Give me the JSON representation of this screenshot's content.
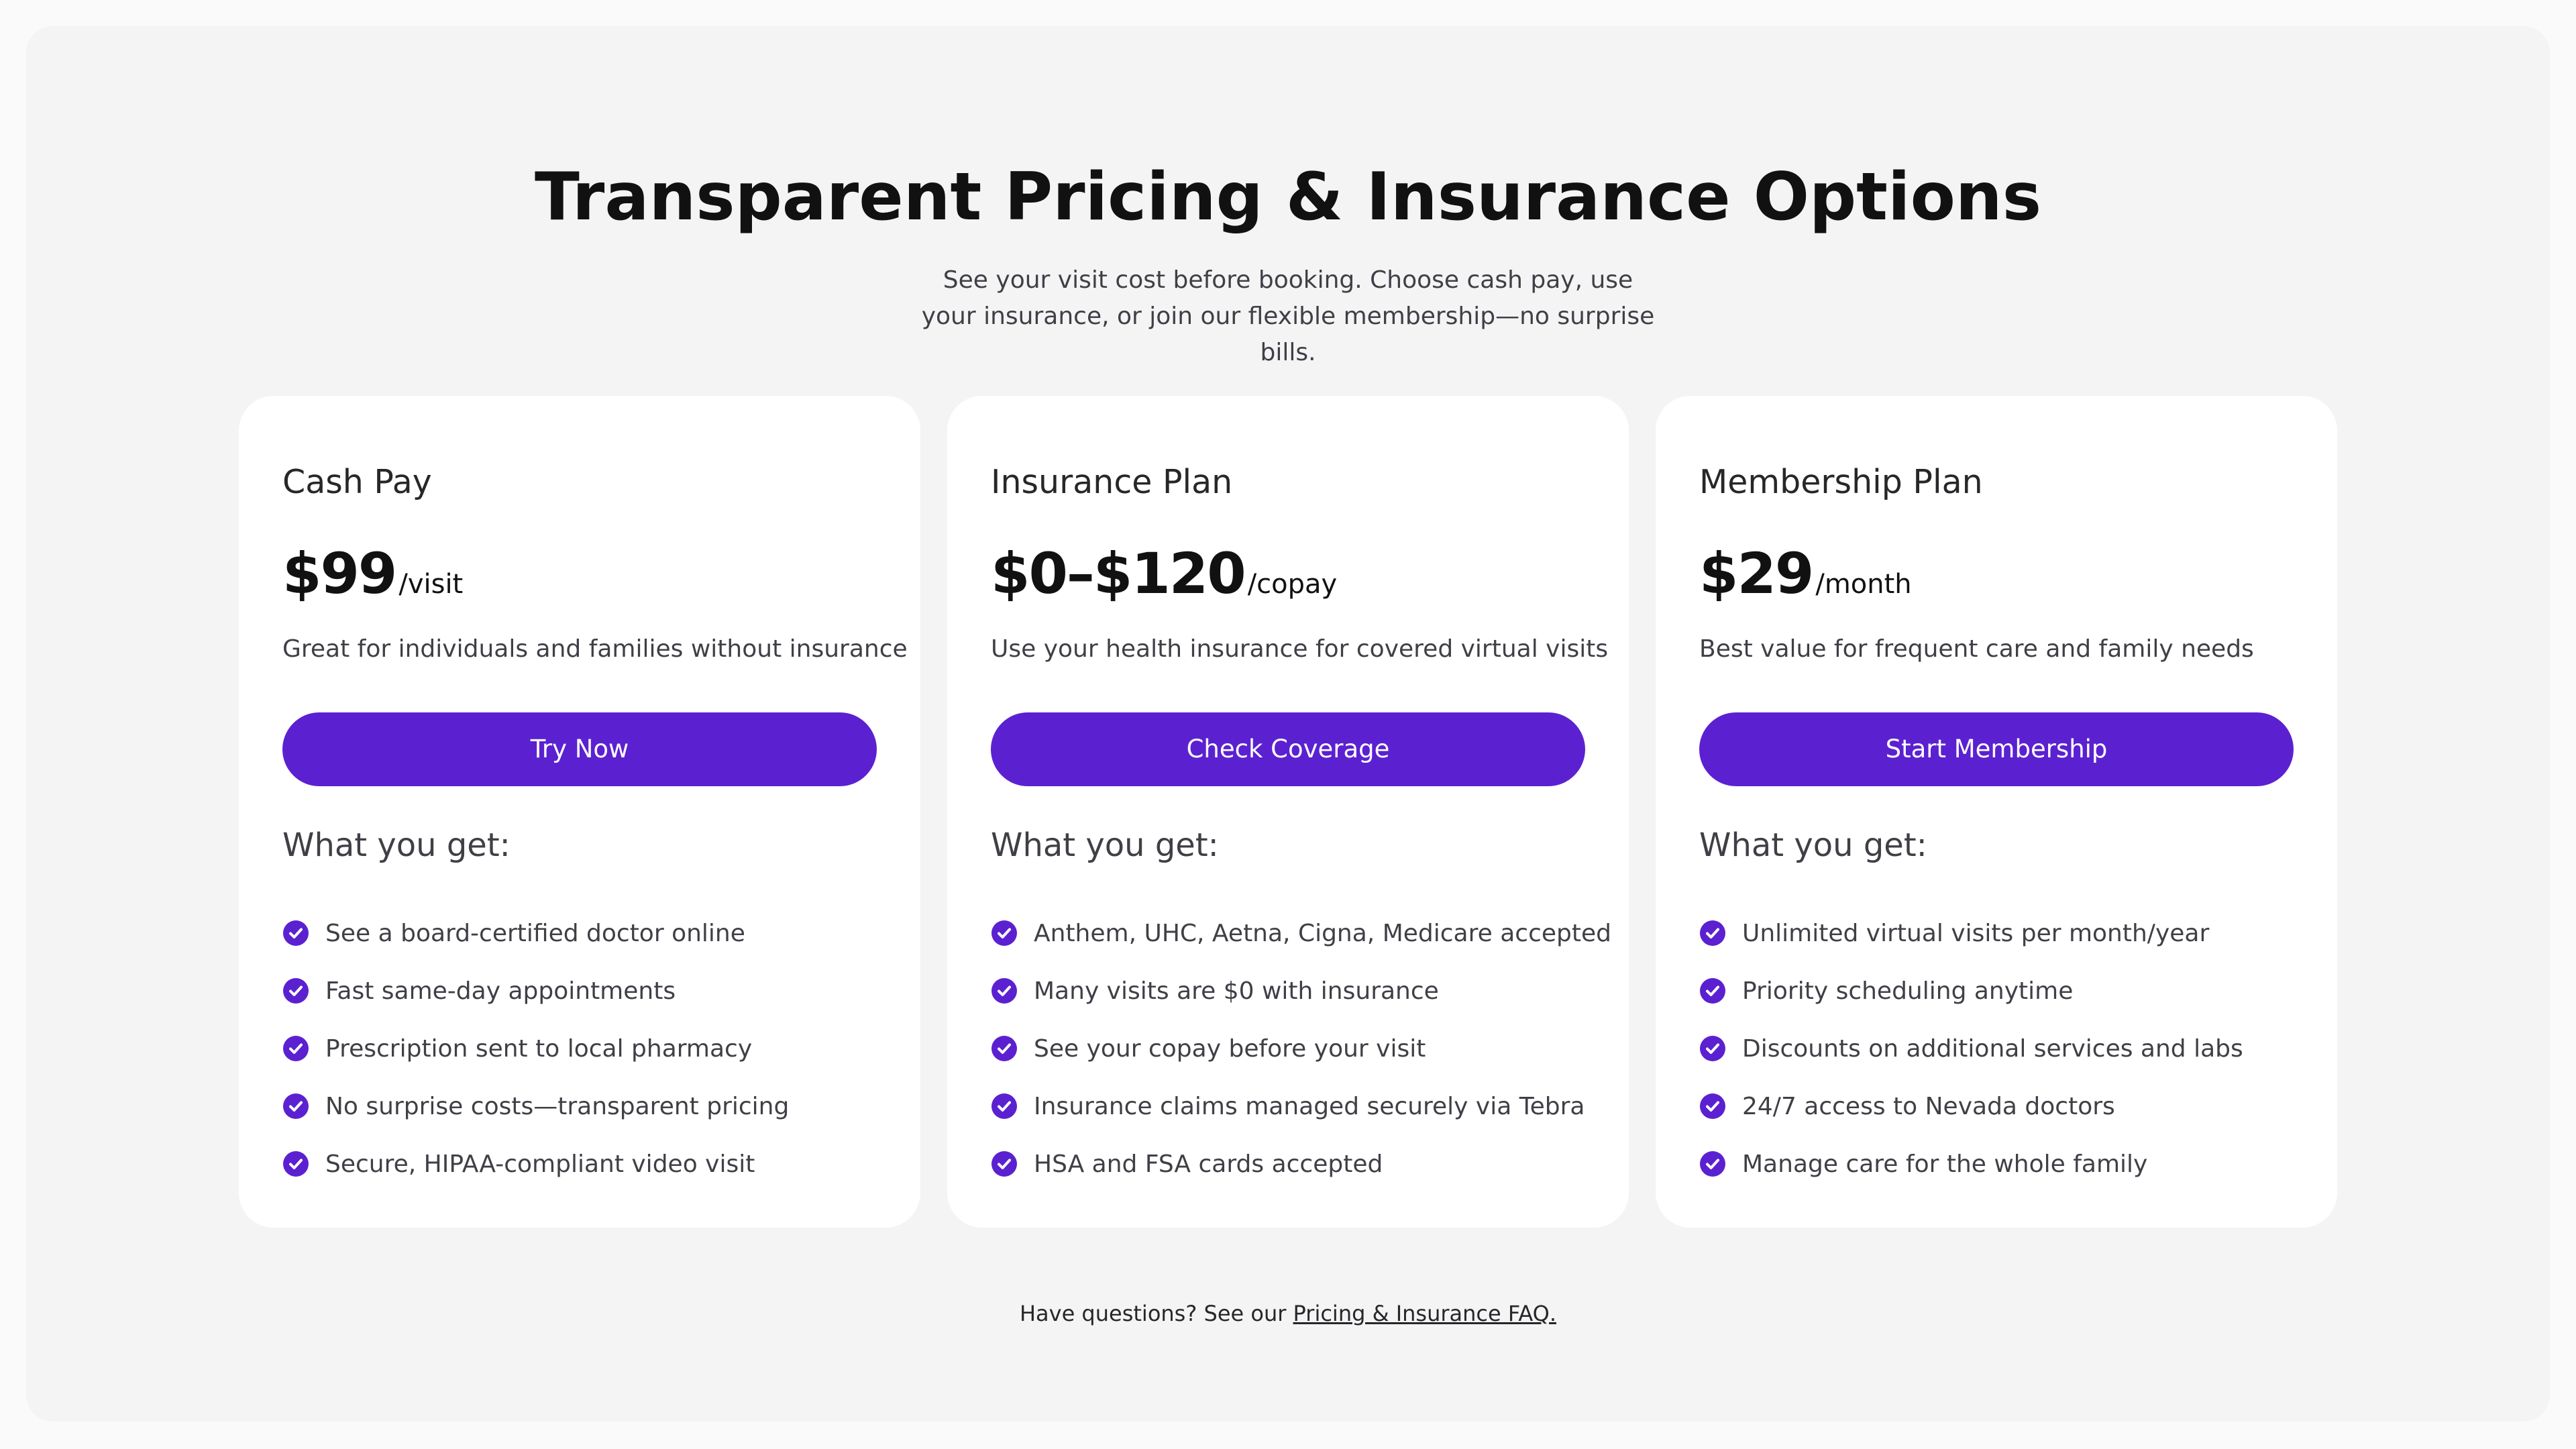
{
  "header": {
    "title": "Transparent Pricing & Insurance Options",
    "subtitle": "See your visit cost before booking. Choose cash pay, use your insurance, or join our flexible membership—no surprise bills."
  },
  "plans": [
    {
      "name": "Cash Pay",
      "price": "$99",
      "unit": "/visit",
      "description": "Great for individuals and families without insurance",
      "button_label": "Try Now",
      "features_heading": "What you get:",
      "features": [
        "See a board-certified doctor online",
        "Fast same-day appointments",
        "Prescription sent to local pharmacy",
        "No surprise costs—transparent pricing",
        "Secure, HIPAA-compliant video visit"
      ]
    },
    {
      "name": "Insurance Plan",
      "price": "$0–$120",
      "unit": "/copay",
      "description": "Use your health insurance for covered virtual visits",
      "button_label": "Check Coverage",
      "features_heading": "What you get:",
      "features": [
        "Anthem, UHC, Aetna, Cigna, Medicare accepted",
        "Many visits are $0 with insurance",
        "See your copay before your visit",
        "Insurance claims managed securely via Tebra",
        "HSA and FSA cards accepted"
      ]
    },
    {
      "name": "Membership Plan",
      "price": "$29",
      "unit": "/month",
      "description": "Best value for frequent care and family needs",
      "button_label": "Start Membership",
      "features_heading": "What you get:",
      "features": [
        "Unlimited virtual visits per month/year",
        "Priority scheduling anytime",
        "Discounts on additional services and labs",
        "24/7 access to Nevada doctors",
        "Manage care for the whole family"
      ]
    }
  ],
  "footer": {
    "prefix": "Have questions? See our",
    "link_label": "Pricing & Insurance FAQ."
  },
  "colors": {
    "accent": "#5b21d1",
    "section_bg": "#f4f4f5",
    "card_bg": "#ffffff"
  },
  "icons": {
    "feature_bullet": "check-circle-icon"
  }
}
